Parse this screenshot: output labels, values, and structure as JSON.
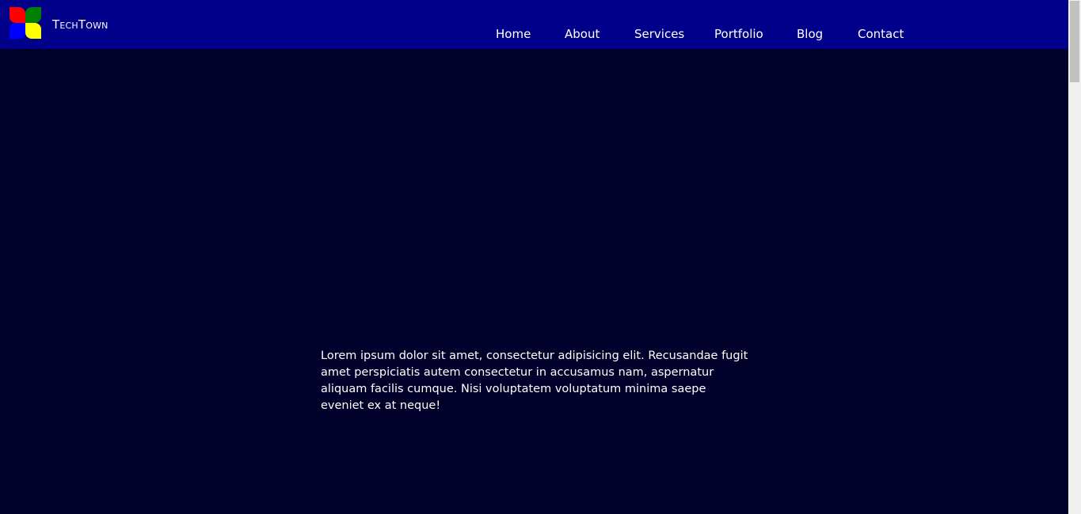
{
  "brand": {
    "name": "TechTown",
    "logo_icon": "four-petal-logo-icon",
    "logo_colors": [
      "#ff0000",
      "#008000",
      "#0000ff",
      "#ffff00"
    ]
  },
  "nav": {
    "items": [
      {
        "label": "Home"
      },
      {
        "label": "About"
      },
      {
        "label": "Services"
      },
      {
        "label": "Portfolio"
      },
      {
        "label": "Blog"
      },
      {
        "label": "Contact"
      }
    ]
  },
  "main": {
    "paragraph": "Lorem ipsum dolor sit amet, consectetur adipisicing elit. Recusandae fugit amet perspiciatis autem consectetur in accusamus nam, aspernatur aliquam facilis cumque. Nisi voluptatem voluptatum minima saepe eveniet ex at neque!"
  },
  "colors": {
    "navbar_bg": "#00008b",
    "page_bg": "#00002a",
    "text": "#ffffff"
  }
}
